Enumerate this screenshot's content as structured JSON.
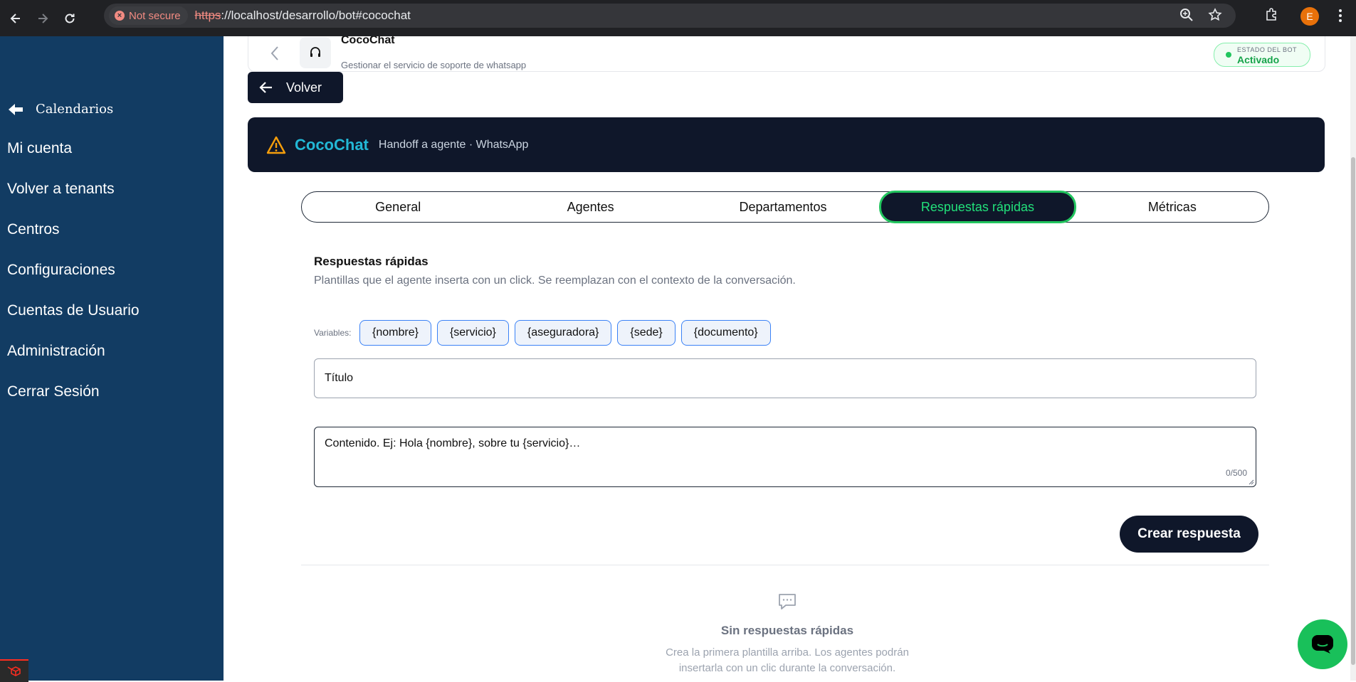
{
  "browser": {
    "security_label": "Not secure",
    "url_scheme": "https",
    "url_rest": "://localhost/desarrollo/bot#cocochat",
    "profile_initial": "E"
  },
  "sidebar": {
    "back_label": "Calendarios",
    "items": [
      {
        "label": "Mi cuenta"
      },
      {
        "label": "Volver a tenants"
      },
      {
        "label": "Centros"
      },
      {
        "label": "Configuraciones"
      },
      {
        "label": "Cuentas de Usuario"
      },
      {
        "label": "Administración"
      },
      {
        "label": "Cerrar Sesión"
      }
    ]
  },
  "bot_card": {
    "name": "CocoChat",
    "subtitle": "Gestionar el servicio de soporte de whatsapp",
    "status_label": "ESTADO DEL BOT",
    "status_value": "Activado"
  },
  "back_button": {
    "label": "Volver"
  },
  "banner": {
    "brand": "CocoChat",
    "subtitle": "Handoff a agente · WhatsApp"
  },
  "tabs": [
    {
      "label": "General",
      "active": false
    },
    {
      "label": "Agentes",
      "active": false
    },
    {
      "label": "Departamentos",
      "active": false
    },
    {
      "label": "Respuestas rápidas",
      "active": true
    },
    {
      "label": "Métricas",
      "active": false
    }
  ],
  "section": {
    "title": "Respuestas rápidas",
    "description": "Plantillas que el agente inserta con un click. Se reemplazan con el contexto de la conversación."
  },
  "variables": {
    "label": "Variables:",
    "chips": [
      "{nombre}",
      "{servicio}",
      "{aseguradora}",
      "{sede}",
      "{documento}"
    ]
  },
  "form": {
    "title_placeholder": "Título",
    "content_placeholder": "Contenido. Ej: Hola {nombre}, sobre tu {servicio}…",
    "counter": "0/500",
    "submit_label": "Crear respuesta"
  },
  "empty_state": {
    "title": "Sin respuestas rápidas",
    "description": "Crea la primera plantilla arriba. Los agentes podrán insertarla con un clic durante la conversación."
  },
  "colors": {
    "sidebar_bg": "#123c63",
    "dark_navy": "#0f172a",
    "brand_cyan": "#22b8d6",
    "active_green": "#22c55e",
    "fab_green": "#19c05a",
    "chip_border": "#3b82f6"
  }
}
